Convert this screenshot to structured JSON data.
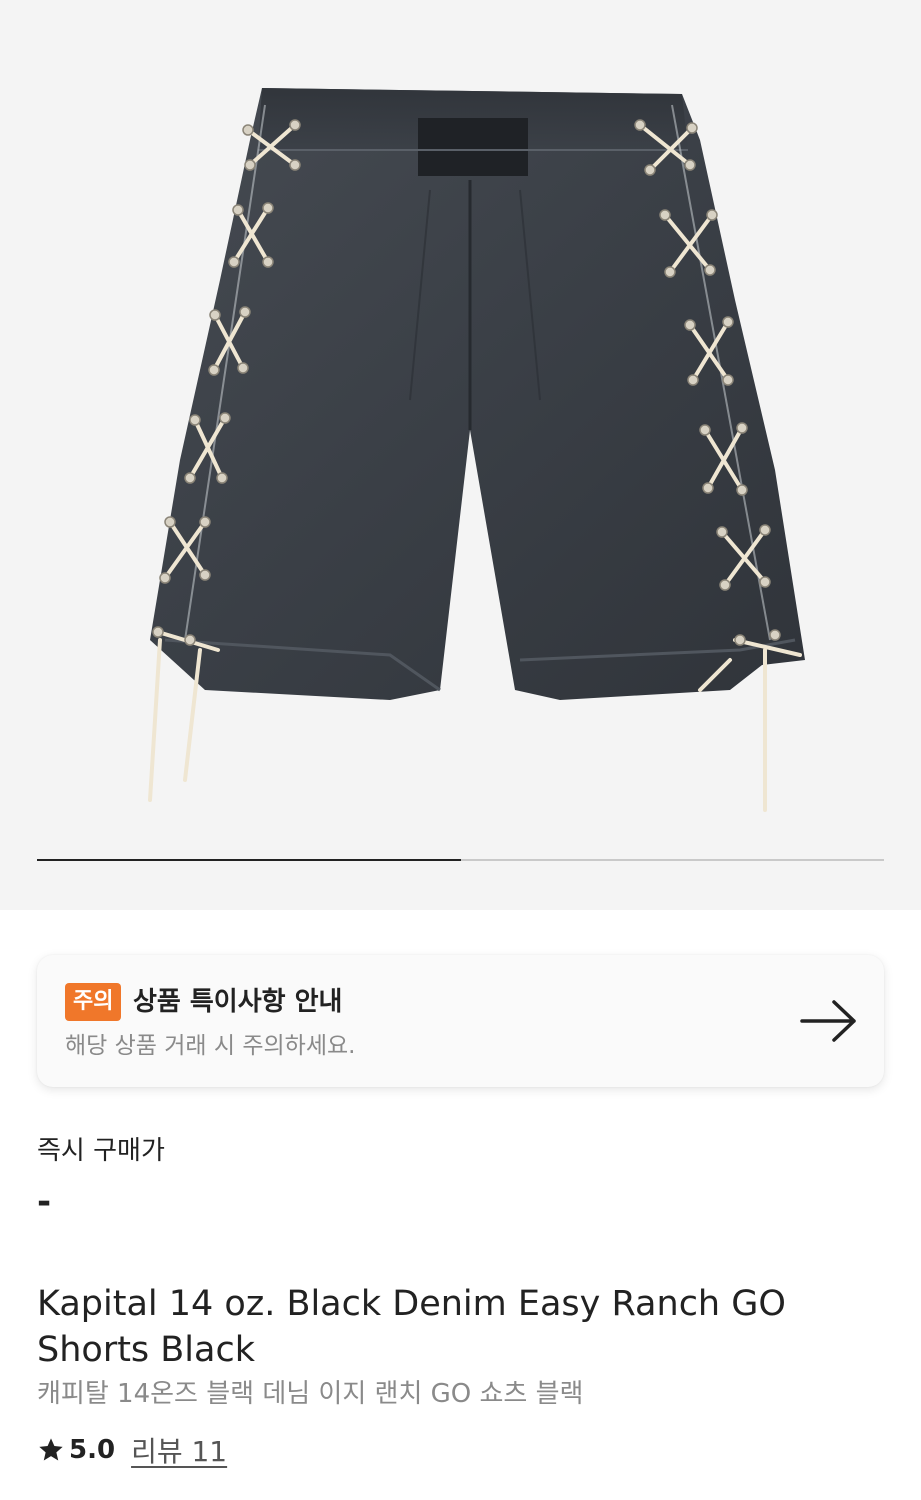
{
  "gallery": {
    "image_alt": "Kapital 14 oz. Black Denim Easy Ranch GO Shorts Black",
    "progress": 0.5
  },
  "notice": {
    "badge": "주의",
    "title": "상품 특이사항 안내",
    "description": "해당 상품 거래 시 주의하세요.",
    "arrow_icon": "arrow-right-icon"
  },
  "price": {
    "label": "즉시 구매가",
    "value": "-"
  },
  "product": {
    "title": "Kapital 14 oz. Black Denim Easy Ranch GO Shorts Black",
    "subtitle": "캐피탈 14온즈 블랙 데님 이지 랜치 GO 쇼츠 블랙",
    "rating": "5.0",
    "review_label": "리뷰 11"
  },
  "colors": {
    "badge": "#f0772a",
    "hero_background": "#f4f4f4",
    "denim": "#3b4047"
  }
}
